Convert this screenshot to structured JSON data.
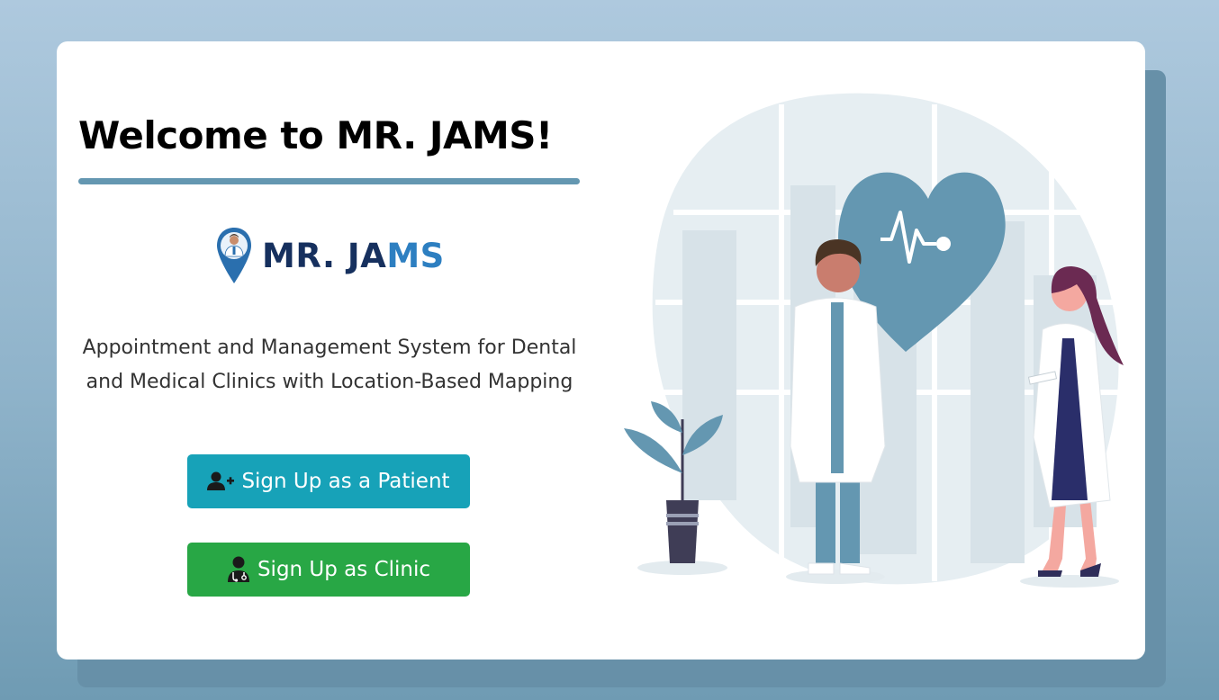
{
  "welcome": {
    "title": "Welcome to MR. JAMS!"
  },
  "logo": {
    "text_main": "MR. JA",
    "text_accent": "MS"
  },
  "description": {
    "line1": "Appointment and Management System for Dental",
    "line2": "and Medical Clinics with Location-Based Mapping"
  },
  "buttons": {
    "patient_label": "Sign Up as a Patient",
    "patient_icon": "user-plus-icon",
    "clinic_label": "Sign Up as Clinic",
    "clinic_icon": "user-doctor-icon"
  },
  "illustration": {
    "icon": "doctors-illustration"
  },
  "colors": {
    "accent": "#6497b1",
    "patient_button": "#17a2b8",
    "clinic_button": "#28a745",
    "brand_dark": "#16305e",
    "brand_light": "#2d7fc1"
  }
}
